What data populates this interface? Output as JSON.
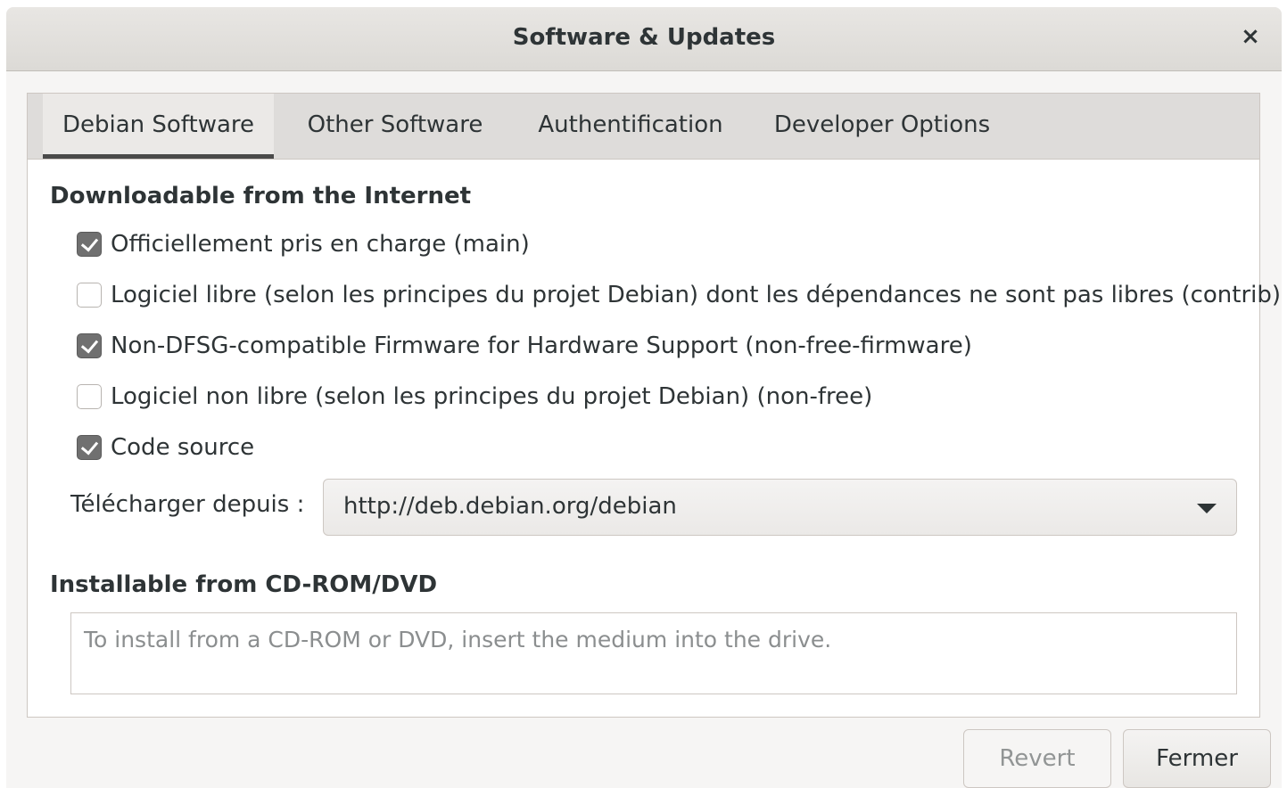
{
  "window": {
    "title": "Software & Updates",
    "close_glyph": "×"
  },
  "tabs": [
    {
      "label": "Debian Software",
      "active": true
    },
    {
      "label": "Other Software",
      "active": false
    },
    {
      "label": "Authentification",
      "active": false
    },
    {
      "label": "Developer Options",
      "active": false
    }
  ],
  "internet": {
    "heading": "Downloadable from the Internet",
    "components": [
      {
        "label": "Officiellement pris en charge (main)",
        "checked": true
      },
      {
        "label": "Logiciel libre (selon les principes du projet Debian) dont les dépendances ne sont pas libres (contrib)",
        "checked": false
      },
      {
        "label": "Non-DFSG-compatible Firmware for Hardware Support (non-free-firmware)",
        "checked": true
      },
      {
        "label": "Logiciel non libre (selon les principes du projet Debian) (non-free)",
        "checked": false
      },
      {
        "label": "Code source",
        "checked": true
      }
    ],
    "download_from_label": "Télécharger depuis :",
    "download_from_value": "http://deb.debian.org/debian"
  },
  "cdrom": {
    "heading": "Installable from CD-ROM/DVD",
    "placeholder": "To install from a CD-ROM or DVD, insert the medium into the drive."
  },
  "buttons": {
    "revert": "Revert",
    "close": "Fermer"
  },
  "colors": {
    "window_bg": "#f6f5f4",
    "titlebar_bg": "#dcdad6",
    "tabbar_bg": "#dedcda",
    "checkbox_checked": "#707070",
    "active_tab_underline": "#4a4a4a"
  }
}
